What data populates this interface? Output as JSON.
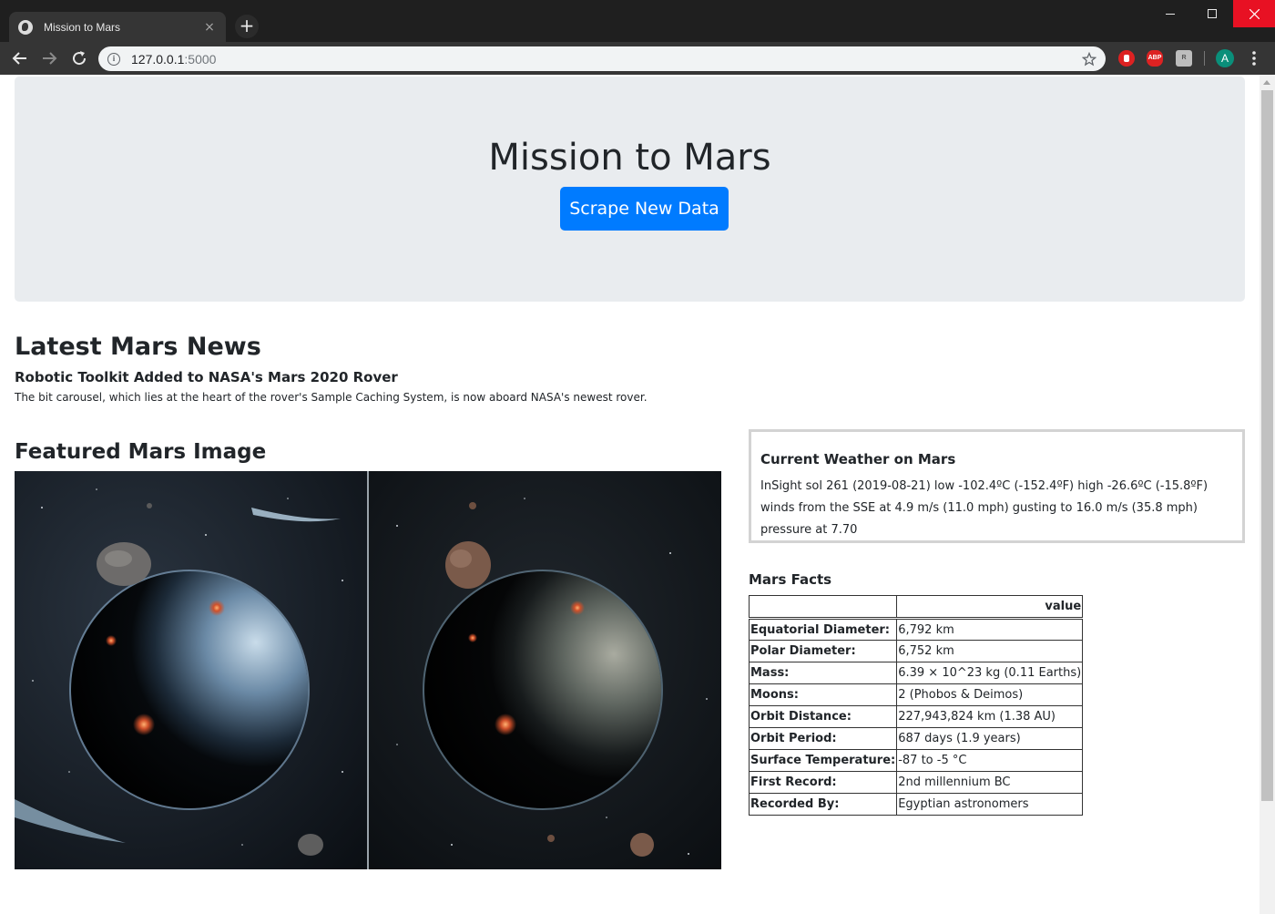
{
  "browser": {
    "tab_title": "Mission to Mars",
    "tab_close": "×",
    "new_tab": "+",
    "url_host": "127.0.0.1",
    "url_port": ":5000",
    "ext_abp": "ABP",
    "ext_grey": "R",
    "avatar_initial": "A"
  },
  "jumbotron": {
    "title": "Mission to Mars",
    "button_label": "Scrape New Data"
  },
  "news": {
    "heading": "Latest Mars News",
    "title": "Robotic Toolkit Added to NASA's Mars 2020 Rover",
    "teaser": "The bit carousel, which lies at the heart of the rover's Sample Caching System, is now aboard NASA's newest rover."
  },
  "featured_image": {
    "heading": "Featured Mars Image"
  },
  "weather": {
    "title": "Current Weather on Mars",
    "text": "InSight sol 261 (2019-08-21) low -102.4ºC (-152.4ºF) high -26.6ºC (-15.8ºF) winds from the SSE at 4.9 m/s (11.0 mph) gusting to 16.0 m/s (35.8 mph) pressure at 7.70"
  },
  "facts": {
    "heading": "Mars Facts",
    "column_header": "value",
    "rows": [
      {
        "label": "Equatorial Diameter:",
        "value": "6,792 km"
      },
      {
        "label": "Polar Diameter:",
        "value": "6,752 km"
      },
      {
        "label": "Mass:",
        "value": "6.39 × 10^23 kg (0.11 Earths)"
      },
      {
        "label": "Moons:",
        "value": "2 (Phobos & Deimos)"
      },
      {
        "label": "Orbit Distance:",
        "value": "227,943,824 km (1.38 AU)"
      },
      {
        "label": "Orbit Period:",
        "value": "687 days (1.9 years)"
      },
      {
        "label": "Surface Temperature:",
        "value": "-87 to -5 °C"
      },
      {
        "label": "First Record:",
        "value": "2nd millennium BC"
      },
      {
        "label": "Recorded By:",
        "value": "Egyptian astronomers"
      }
    ]
  },
  "colors": {
    "primary_button": "#007bff",
    "jumbotron_bg": "#e9ecef",
    "weather_border": "#d3d3d3"
  }
}
